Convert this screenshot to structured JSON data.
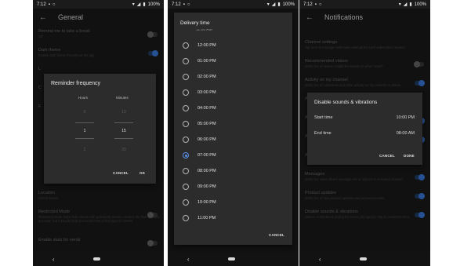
{
  "status": {
    "time": "7:12",
    "battery": "100%"
  },
  "screen1": {
    "title": "General",
    "rows": [
      {
        "title": "Remind me to take a break",
        "subtitle": "Off",
        "toggle": "off"
      },
      {
        "title": "Dark theme",
        "subtitle": "Enable dark theme throughout the app",
        "toggle": "on"
      },
      {
        "title": "L",
        "subtitle": "",
        "toggle": "none"
      },
      {
        "title": "C",
        "subtitle": "",
        "toggle": "none"
      },
      {
        "title": "F",
        "subtitle": "",
        "toggle": "none"
      },
      {
        "title": "",
        "subtitle": "",
        "toggle": "none"
      },
      {
        "title": "Location",
        "subtitle": "United States",
        "toggle": "none"
      },
      {
        "title": "Restricted Mode",
        "subtitle": "Restricted Mode helps hide videos with potentially mature content. No filter is 100% accurate, but it should help you avoid most of this type of content.",
        "toggle": "off"
      },
      {
        "title": "Enable stats for nerds",
        "subtitle": "",
        "toggle": "off"
      }
    ],
    "dialog": {
      "title": "Reminder frequency",
      "hours_label": "Hours",
      "minutes_label": "Minutes",
      "hours": [
        "0",
        "1",
        "2"
      ],
      "minutes": [
        "10",
        "15",
        "20"
      ],
      "cancel": "CANCEL",
      "ok": "OK"
    }
  },
  "screen2": {
    "dialog": {
      "title": "Delivery time",
      "peek": "11:00 AM",
      "options": [
        {
          "label": "12:00 PM",
          "selected": false
        },
        {
          "label": "01:00 PM",
          "selected": false
        },
        {
          "label": "02:00 PM",
          "selected": false
        },
        {
          "label": "03:00 PM",
          "selected": false
        },
        {
          "label": "04:00 PM",
          "selected": false
        },
        {
          "label": "05:00 PM",
          "selected": false
        },
        {
          "label": "06:00 PM",
          "selected": false
        },
        {
          "label": "07:00 PM",
          "selected": true
        },
        {
          "label": "08:00 PM",
          "selected": false
        },
        {
          "label": "09:00 PM",
          "selected": false
        },
        {
          "label": "10:00 PM",
          "selected": false
        },
        {
          "label": "11:00 PM",
          "selected": false
        }
      ],
      "cancel": "CANCEL"
    }
  },
  "screen3": {
    "title": "Notifications",
    "rows": [
      {
        "title": "",
        "subtitle": "",
        "toggle": "none"
      },
      {
        "title": "Channel settings",
        "subtitle": "Tap here to manage notification settings for each subscribed channel",
        "toggle": "none"
      },
      {
        "title": "Recommended videos",
        "subtitle": "Notify me of videos I might like based on what I watch",
        "toggle": "off"
      },
      {
        "title": "Activity on my channel",
        "subtitle": "Notify me of comments and other activity on my channel or videos",
        "toggle": "on"
      },
      {
        "title": "A",
        "subtitle": "",
        "toggle": "none"
      },
      {
        "title": "A",
        "subtitle": "",
        "toggle": "on"
      },
      {
        "title": "A",
        "subtitle": "",
        "toggle": "on"
      },
      {
        "title": "A",
        "subtitle": "",
        "toggle": "none"
      },
      {
        "title": "Messages",
        "subtitle": "Notify me when others message me or add me to a shared channel",
        "toggle": "on"
      },
      {
        "title": "Product updates",
        "subtitle": "Notify me of new product updates and announcements",
        "toggle": "on"
      },
      {
        "title": "Disable sounds & vibrations",
        "subtitle": "Silence notifications during the hours you specify. Tap to customize time.",
        "toggle": "on"
      }
    ],
    "dialog": {
      "title": "Disable sounds & vibrations",
      "start_label": "Start time",
      "start_value": "10:00 PM",
      "end_label": "End time",
      "end_value": "08:00 AM",
      "cancel": "CANCEL",
      "done": "DONE"
    }
  },
  "colors": {
    "accent": "#5a90e8",
    "background": "#1b1b1b",
    "dialog": "#2c2c2c"
  },
  "icons": [
    "back-arrow-icon",
    "wifi-icon",
    "cell-signal-icon",
    "battery-icon",
    "nav-back-icon",
    "nav-home-icon"
  ]
}
